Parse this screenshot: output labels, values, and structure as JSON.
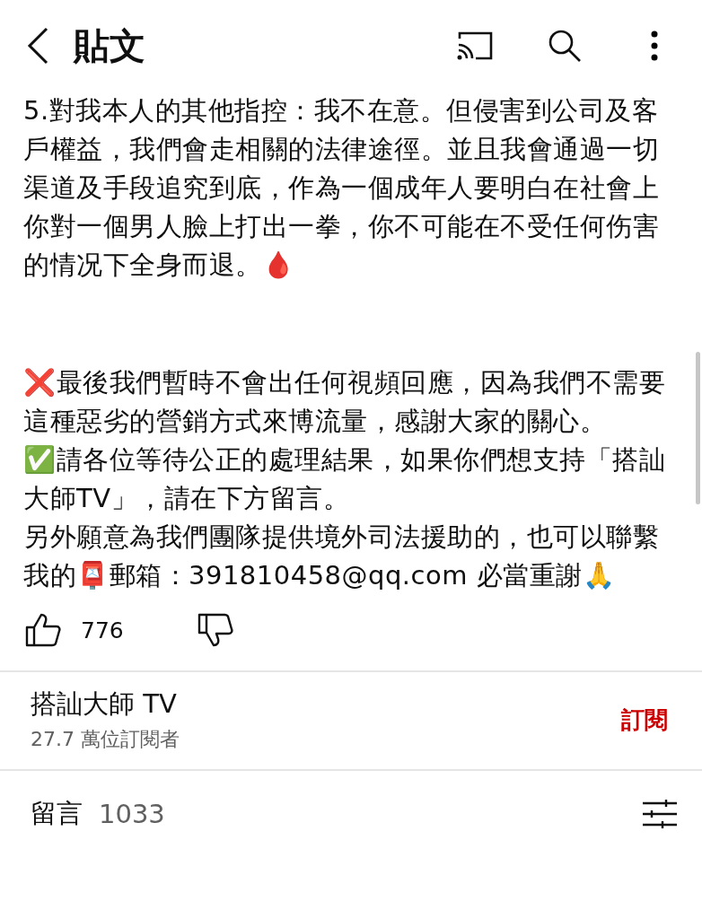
{
  "header": {
    "title": "貼文"
  },
  "paragraphs": [
    "5.對我本人的其他指控：我不在意。但侵害到公司及客戶權益，我們會走相關的法律途徑。並且我會通過一切渠道及手段追究到底，作為一個成年人要明白在社會上你對一個男人臉上打出一拳，你不可能在不受任何伤害的情况下全身而退。🩸",
    "❌最後我們暫時不會出任何視頻回應，因為我們不需要這種惡劣的營銷方式來博流量，感謝大家的關心。",
    "✅請各位等待公正的處理結果，如果你們想支持「搭訕大師TV」，請在下方留言。",
    "另外願意為我們團隊提供境外司法援助的，也可以聯繫我的📮郵箱：391810458@qq.com 必當重謝🙏"
  ],
  "likes": {
    "count": "776"
  },
  "channel": {
    "name": "搭訕大師 TV",
    "subscribers": "27.7 萬位訂閱者",
    "subscribe_label": "訂閱"
  },
  "comments": {
    "label": "留言",
    "count": "1033"
  }
}
